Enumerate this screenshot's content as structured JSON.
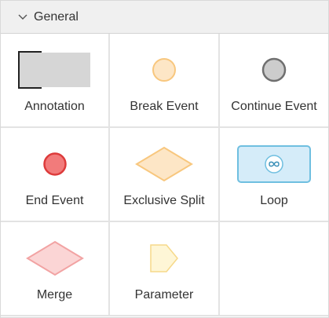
{
  "section": {
    "title": "General",
    "chevron_icon": "chevron-down-icon"
  },
  "items": [
    {
      "label": "Annotation",
      "icon": "annotation-icon"
    },
    {
      "label": "Break Event",
      "icon": "break-event-icon"
    },
    {
      "label": "Continue Event",
      "icon": "continue-event-icon"
    },
    {
      "label": "End Event",
      "icon": "end-event-icon"
    },
    {
      "label": "Exclusive Split",
      "icon": "exclusive-split-icon"
    },
    {
      "label": "Loop",
      "icon": "loop-icon"
    },
    {
      "label": "Merge",
      "icon": "merge-icon"
    },
    {
      "label": "Parameter",
      "icon": "parameter-icon"
    }
  ],
  "colors": {
    "annotation_fill": "#d6d6d6",
    "break_fill": "#fde6c6",
    "break_stroke": "#f8c77e",
    "continue_fill": "#cccccc",
    "continue_stroke": "#6f6f6f",
    "end_fill": "#f27b7b",
    "end_stroke": "#dd3b3b",
    "split_fill": "#fde6c6",
    "split_stroke": "#f8c77e",
    "loop_fill": "#d5ecf9",
    "loop_stroke": "#6fbfe0",
    "merge_fill": "#fbd5d5",
    "merge_stroke": "#f2a3a3",
    "parameter_fill": "#fef6d6",
    "parameter_stroke": "#f6d98a"
  }
}
